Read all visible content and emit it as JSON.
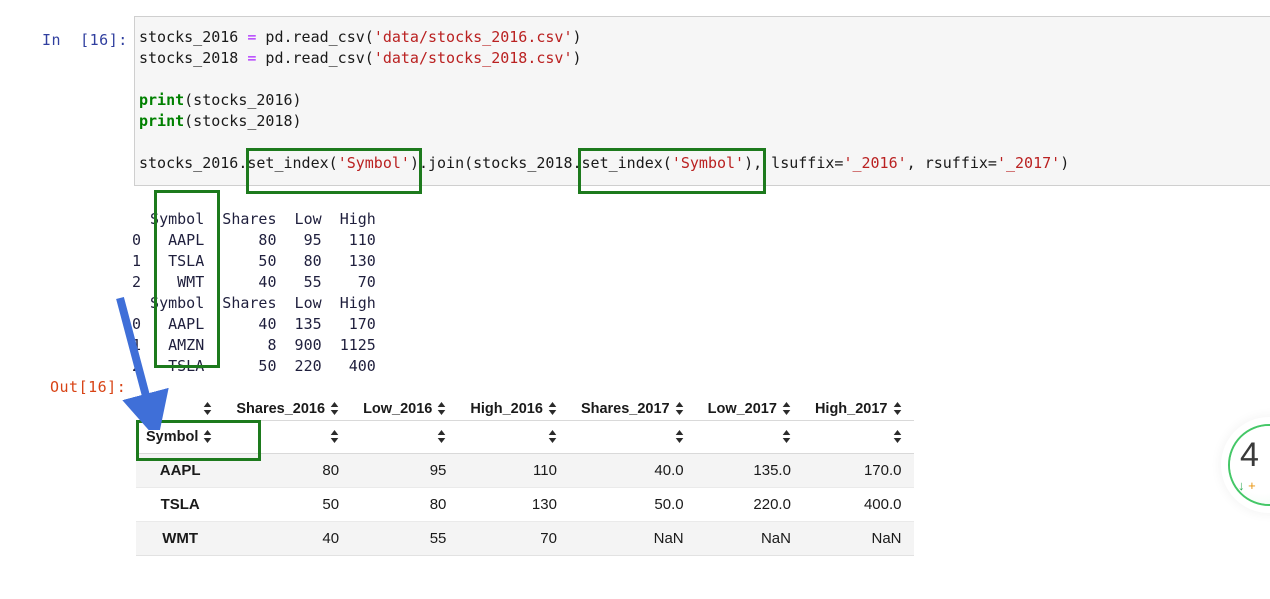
{
  "notebook": {
    "in_prompt": "In  [16]:",
    "out_prompt": "Out[16]:",
    "code_lines": [
      [
        {
          "t": "stocks_2016 ",
          "c": "plain"
        },
        {
          "t": "=",
          "c": "op"
        },
        {
          "t": " pd.read_csv(",
          "c": "plain"
        },
        {
          "t": "'data/stocks_2016.csv'",
          "c": "str"
        },
        {
          "t": ")",
          "c": "plain"
        }
      ],
      [
        {
          "t": "stocks_2018 ",
          "c": "plain"
        },
        {
          "t": "=",
          "c": "op"
        },
        {
          "t": " pd.read_csv(",
          "c": "plain"
        },
        {
          "t": "'data/stocks_2018.csv'",
          "c": "str"
        },
        {
          "t": ")",
          "c": "plain"
        }
      ],
      [],
      [
        {
          "t": "print",
          "c": "fn"
        },
        {
          "t": "(stocks_2016)",
          "c": "plain"
        }
      ],
      [
        {
          "t": "print",
          "c": "fn"
        },
        {
          "t": "(stocks_2018)",
          "c": "plain"
        }
      ],
      [],
      [
        {
          "t": "stocks_2016.set_index(",
          "c": "plain"
        },
        {
          "t": "'Symbol'",
          "c": "str"
        },
        {
          "t": ").join(stocks_2018.set_index(",
          "c": "plain"
        },
        {
          "t": "'Symbol'",
          "c": "str"
        },
        {
          "t": "), lsuffix=",
          "c": "plain"
        },
        {
          "t": "'_2016'",
          "c": "str"
        },
        {
          "t": ", rsuffix=",
          "c": "plain"
        },
        {
          "t": "'_2017'",
          "c": "str"
        },
        {
          "t": ")",
          "c": "plain"
        }
      ]
    ],
    "stdout_text": "  Symbol  Shares  Low  High\n0   AAPL      80   95   110\n1   TSLA      50   80   130\n2    WMT      40   55    70\n  Symbol  Shares  Low  High\n0   AAPL      40  135   170\n1   AMZN       8  900  1125\n2   TSLA      50  220   400"
  },
  "output_table": {
    "columns": [
      "Shares_2016",
      "Low_2016",
      "High_2016",
      "Shares_2017",
      "Low_2017",
      "High_2017"
    ],
    "index_name": "Symbol",
    "rows": [
      {
        "index": "AAPL",
        "values": [
          "80",
          "95",
          "110",
          "40.0",
          "135.0",
          "170.0"
        ]
      },
      {
        "index": "TSLA",
        "values": [
          "50",
          "80",
          "130",
          "50.0",
          "220.0",
          "400.0"
        ]
      },
      {
        "index": "WMT",
        "values": [
          "40",
          "55",
          "70",
          "NaN",
          "NaN",
          "NaN"
        ]
      }
    ]
  },
  "annotations": {
    "box_color": "#1d7a1d",
    "arrow_color": "#3f6fd8",
    "boxes": [
      {
        "name": "set-index-call-1",
        "label": "set_index('Symbol')"
      },
      {
        "name": "set-index-call-2",
        "label": "set_index('Symbol')"
      },
      {
        "name": "printed-symbol-column",
        "label": "Symbol"
      },
      {
        "name": "result-index-header",
        "label": "Symbol"
      }
    ]
  },
  "badge": {
    "number": "4",
    "down_icon": "↓",
    "plus_icon": "+"
  }
}
